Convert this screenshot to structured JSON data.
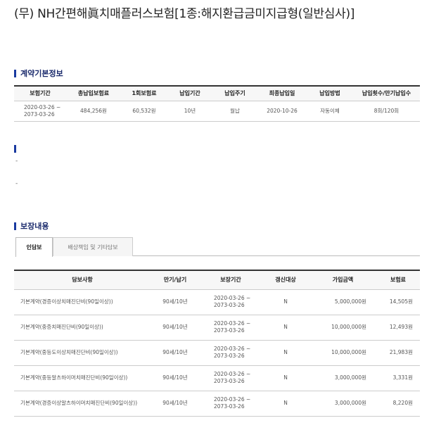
{
  "page_title": "(무) NH간편해眞치매플러스보험[1종:해지환급금미지급형(일반심사)]",
  "contract_section": {
    "title": "계약기본정보",
    "headers": [
      "보험기간",
      "총납입보험료",
      "1회보험료",
      "납입기간",
      "납입주기",
      "최종납입일",
      "납입방법",
      "납입횟수/만기납입수"
    ],
    "row": {
      "period_start": "2020-03-26 ~",
      "period_end": "2073-03-26",
      "total_premium": "484,256원",
      "single_premium": "60,532원",
      "pay_period": "10년",
      "pay_cycle": "월납",
      "last_pay_date": "2020-10-26",
      "pay_method": "자동이체",
      "pay_count": "8회/120회"
    }
  },
  "blank_section": {
    "dash1": "-",
    "dash2": "-"
  },
  "coverage_section": {
    "title": "보장내용",
    "tabs": [
      {
        "label": "인담보",
        "active": true
      },
      {
        "label": "배상책임 및 기타담보",
        "active": false
      }
    ],
    "headers": [
      "담보사항",
      "만기/납기",
      "보장기간",
      "갱신대상",
      "가입금액",
      "보험료"
    ],
    "rows": [
      {
        "name": "기본계약(경증이상치매진단비(90일이상))",
        "term": "90세/10년",
        "start": "2020-03-26 ~",
        "end": "2073-03-26",
        "renew": "N",
        "amount": "5,000,000원",
        "premium": "14,505원"
      },
      {
        "name": "기본계약(중증치매진단비(90일이상))",
        "term": "90세/10년",
        "start": "2020-03-26 ~",
        "end": "2073-03-26",
        "renew": "N",
        "amount": "10,000,000원",
        "premium": "12,493원"
      },
      {
        "name": "기본계약(중등도이상치매진단비(90일이상))",
        "term": "90세/10년",
        "start": "2020-03-26 ~",
        "end": "2073-03-26",
        "renew": "N",
        "amount": "10,000,000원",
        "premium": "21,983원"
      },
      {
        "name": "기본계약(중등알츠하이머치매진단비(90일이상))",
        "term": "90세/10년",
        "start": "2020-03-26 ~",
        "end": "2073-03-26",
        "renew": "N",
        "amount": "3,000,000원",
        "premium": "3,331원"
      },
      {
        "name": "기본계약(경증이상알츠하이머치매진단비(90일이상))",
        "term": "90세/10년",
        "start": "2020-03-26 ~",
        "end": "2073-03-26",
        "renew": "N",
        "amount": "3,000,000원",
        "premium": "8,220원"
      }
    ]
  }
}
